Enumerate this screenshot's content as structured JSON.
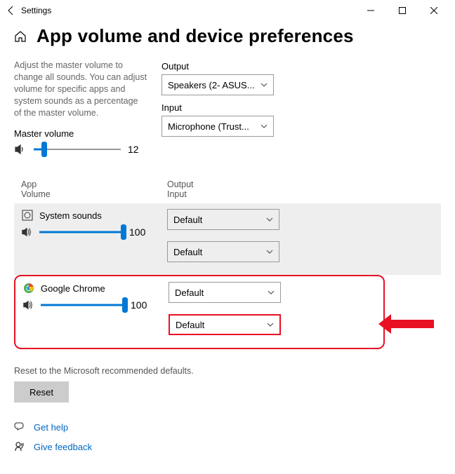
{
  "window": {
    "title": "Settings"
  },
  "page": {
    "title": "App volume and device preferences",
    "description": "Adjust the master volume to change all sounds. You can adjust volume for specific apps and system sounds as a percentage of the master volume."
  },
  "master": {
    "label": "Master volume",
    "value": 12,
    "display": "12"
  },
  "output": {
    "label": "Output",
    "selected": "Speakers (2- ASUS..."
  },
  "input": {
    "label": "Input",
    "selected": "Microphone (Trust..."
  },
  "columns": {
    "app": "App",
    "vol": "Volume",
    "out": "Output",
    "in": "Input"
  },
  "apps": [
    {
      "name": "System sounds",
      "volume": 100,
      "volume_display": "100",
      "output": "Default",
      "input": "Default"
    },
    {
      "name": "Google Chrome",
      "volume": 100,
      "volume_display": "100",
      "output": "Default",
      "input": "Default"
    }
  ],
  "reset": {
    "desc": "Reset to the Microsoft recommended defaults.",
    "button": "Reset"
  },
  "links": {
    "help": "Get help",
    "feedback": "Give feedback"
  }
}
